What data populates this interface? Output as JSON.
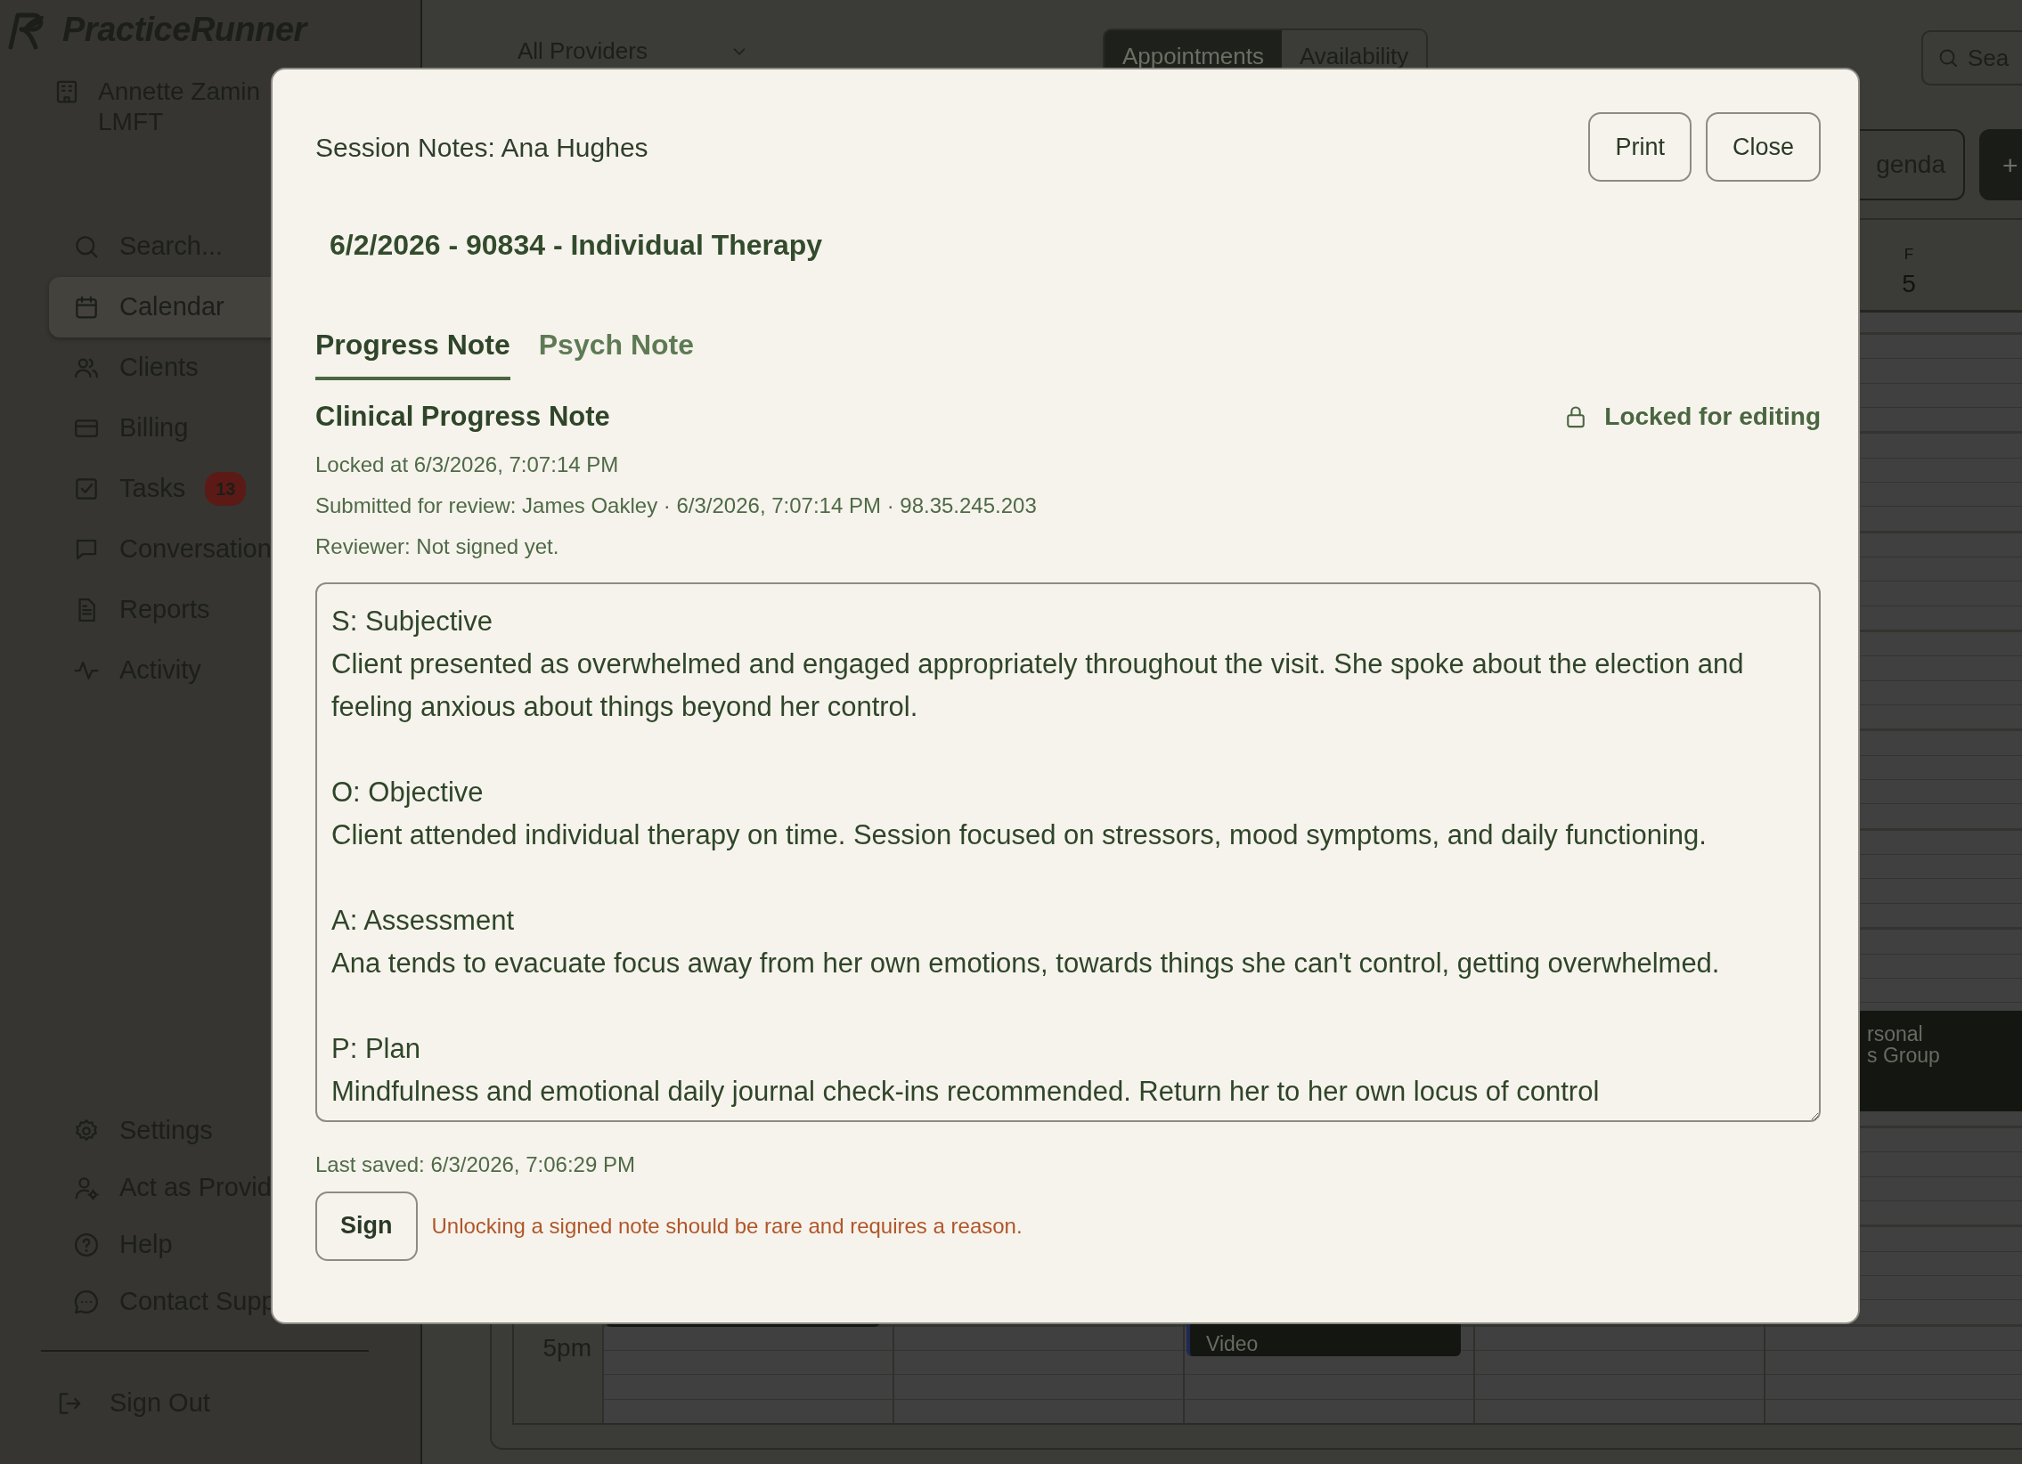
{
  "app": {
    "brand": "PracticeRunner",
    "user": {
      "name": "Annette Zamin",
      "credential": "LMFT"
    },
    "nav": [
      {
        "label": "Search...",
        "selected": false
      },
      {
        "label": "Calendar",
        "selected": true
      },
      {
        "label": "Clients",
        "selected": false
      },
      {
        "label": "Billing",
        "selected": false
      },
      {
        "label": "Tasks",
        "selected": false,
        "badge": "13"
      },
      {
        "label": "Conversation",
        "selected": false
      },
      {
        "label": "Reports",
        "selected": false
      },
      {
        "label": "Activity",
        "selected": false
      }
    ],
    "nav_bottom": [
      {
        "label": "Settings"
      },
      {
        "label": "Act as Provid"
      },
      {
        "label": "Help"
      },
      {
        "label": "Contact Supp"
      }
    ],
    "sign_out": "Sign Out"
  },
  "calendar": {
    "provider_select": "All Providers",
    "view_toggle": [
      {
        "label": "Appointments",
        "selected": true
      },
      {
        "label": "Availability",
        "selected": false
      }
    ],
    "search": {
      "placeholder": "Sea"
    },
    "agenda_button": "genda",
    "add_button": "+",
    "day": {
      "letter": "F",
      "number": "5"
    },
    "time_label": "5pm",
    "events": [
      {
        "kind": "block"
      },
      {
        "kind": "block",
        "lines": [
          "Video"
        ]
      },
      {
        "kind": "block",
        "lines": [
          "rsonal",
          "s Group"
        ]
      }
    ]
  },
  "modal": {
    "title": "Session Notes: Ana Hughes",
    "buttons": [
      "Print",
      "Close"
    ],
    "visit": "6/2/2026 - 90834 - Individual Therapy",
    "tabs": [
      {
        "label": "Progress Note",
        "selected": true
      },
      {
        "label": "Psych Note",
        "selected": false
      }
    ],
    "section_title": "Clinical Progress Note",
    "lock_status": "Locked for editing",
    "meta": [
      "Locked at 6/3/2026, 7:07:14 PM",
      "Submitted for review: James Oakley · 6/3/2026, 7:07:14 PM · 98.35.245.203",
      "Reviewer: Not signed yet."
    ],
    "note_text": "S: Subjective\nClient presented as overwhelmed and engaged appropriately throughout the visit. She spoke about the election and feeling anxious about things beyond her control.\n\nO: Objective\nClient attended individual therapy on time. Session focused on stressors, mood symptoms, and daily functioning.\n\nA: Assessment\nAna tends to evacuate focus away from her own emotions, towards things she can't control, getting overwhelmed.\n\nP: Plan\nMindfulness and emotional daily journal check-ins recommended. Return her to her own locus of control",
    "last_saved": "Last saved: 6/3/2026, 7:06:29 PM",
    "sign_button": "Sign",
    "warning": "Unlocking a signed note should be rare and requires a reason."
  }
}
